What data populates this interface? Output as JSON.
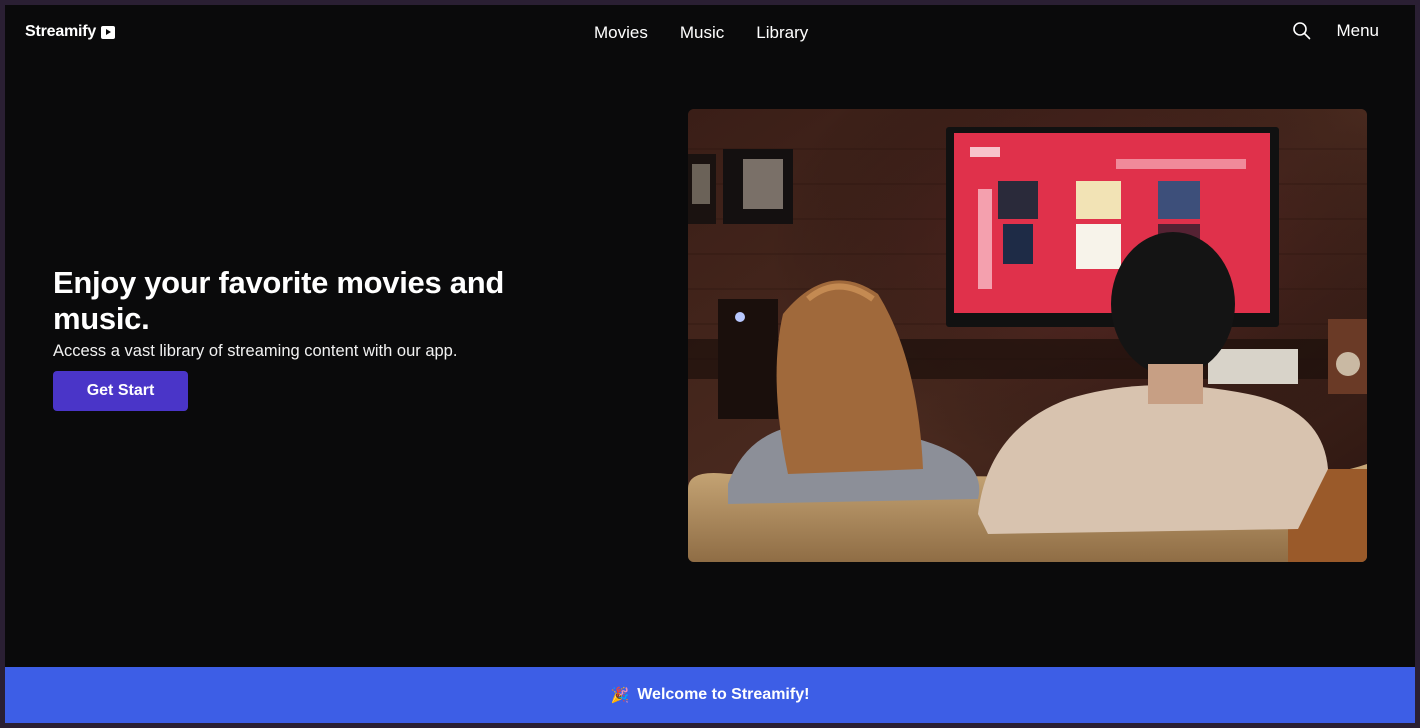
{
  "header": {
    "brand": "Streamify",
    "nav": [
      {
        "label": "Movies"
      },
      {
        "label": "Music"
      },
      {
        "label": "Library"
      }
    ],
    "menu_label": "Menu",
    "icons": {
      "brand": "play-icon",
      "search": "search-icon"
    }
  },
  "hero": {
    "title": "Enjoy your favorite movies and music.",
    "subtitle": "Access a vast library of streaming content with our app.",
    "cta_label": "Get Start",
    "accent": "#4a35c8"
  },
  "banner": {
    "icon": "party-popper-icon",
    "text": "Welcome to Streamify!",
    "color": "#3d5ee6"
  }
}
